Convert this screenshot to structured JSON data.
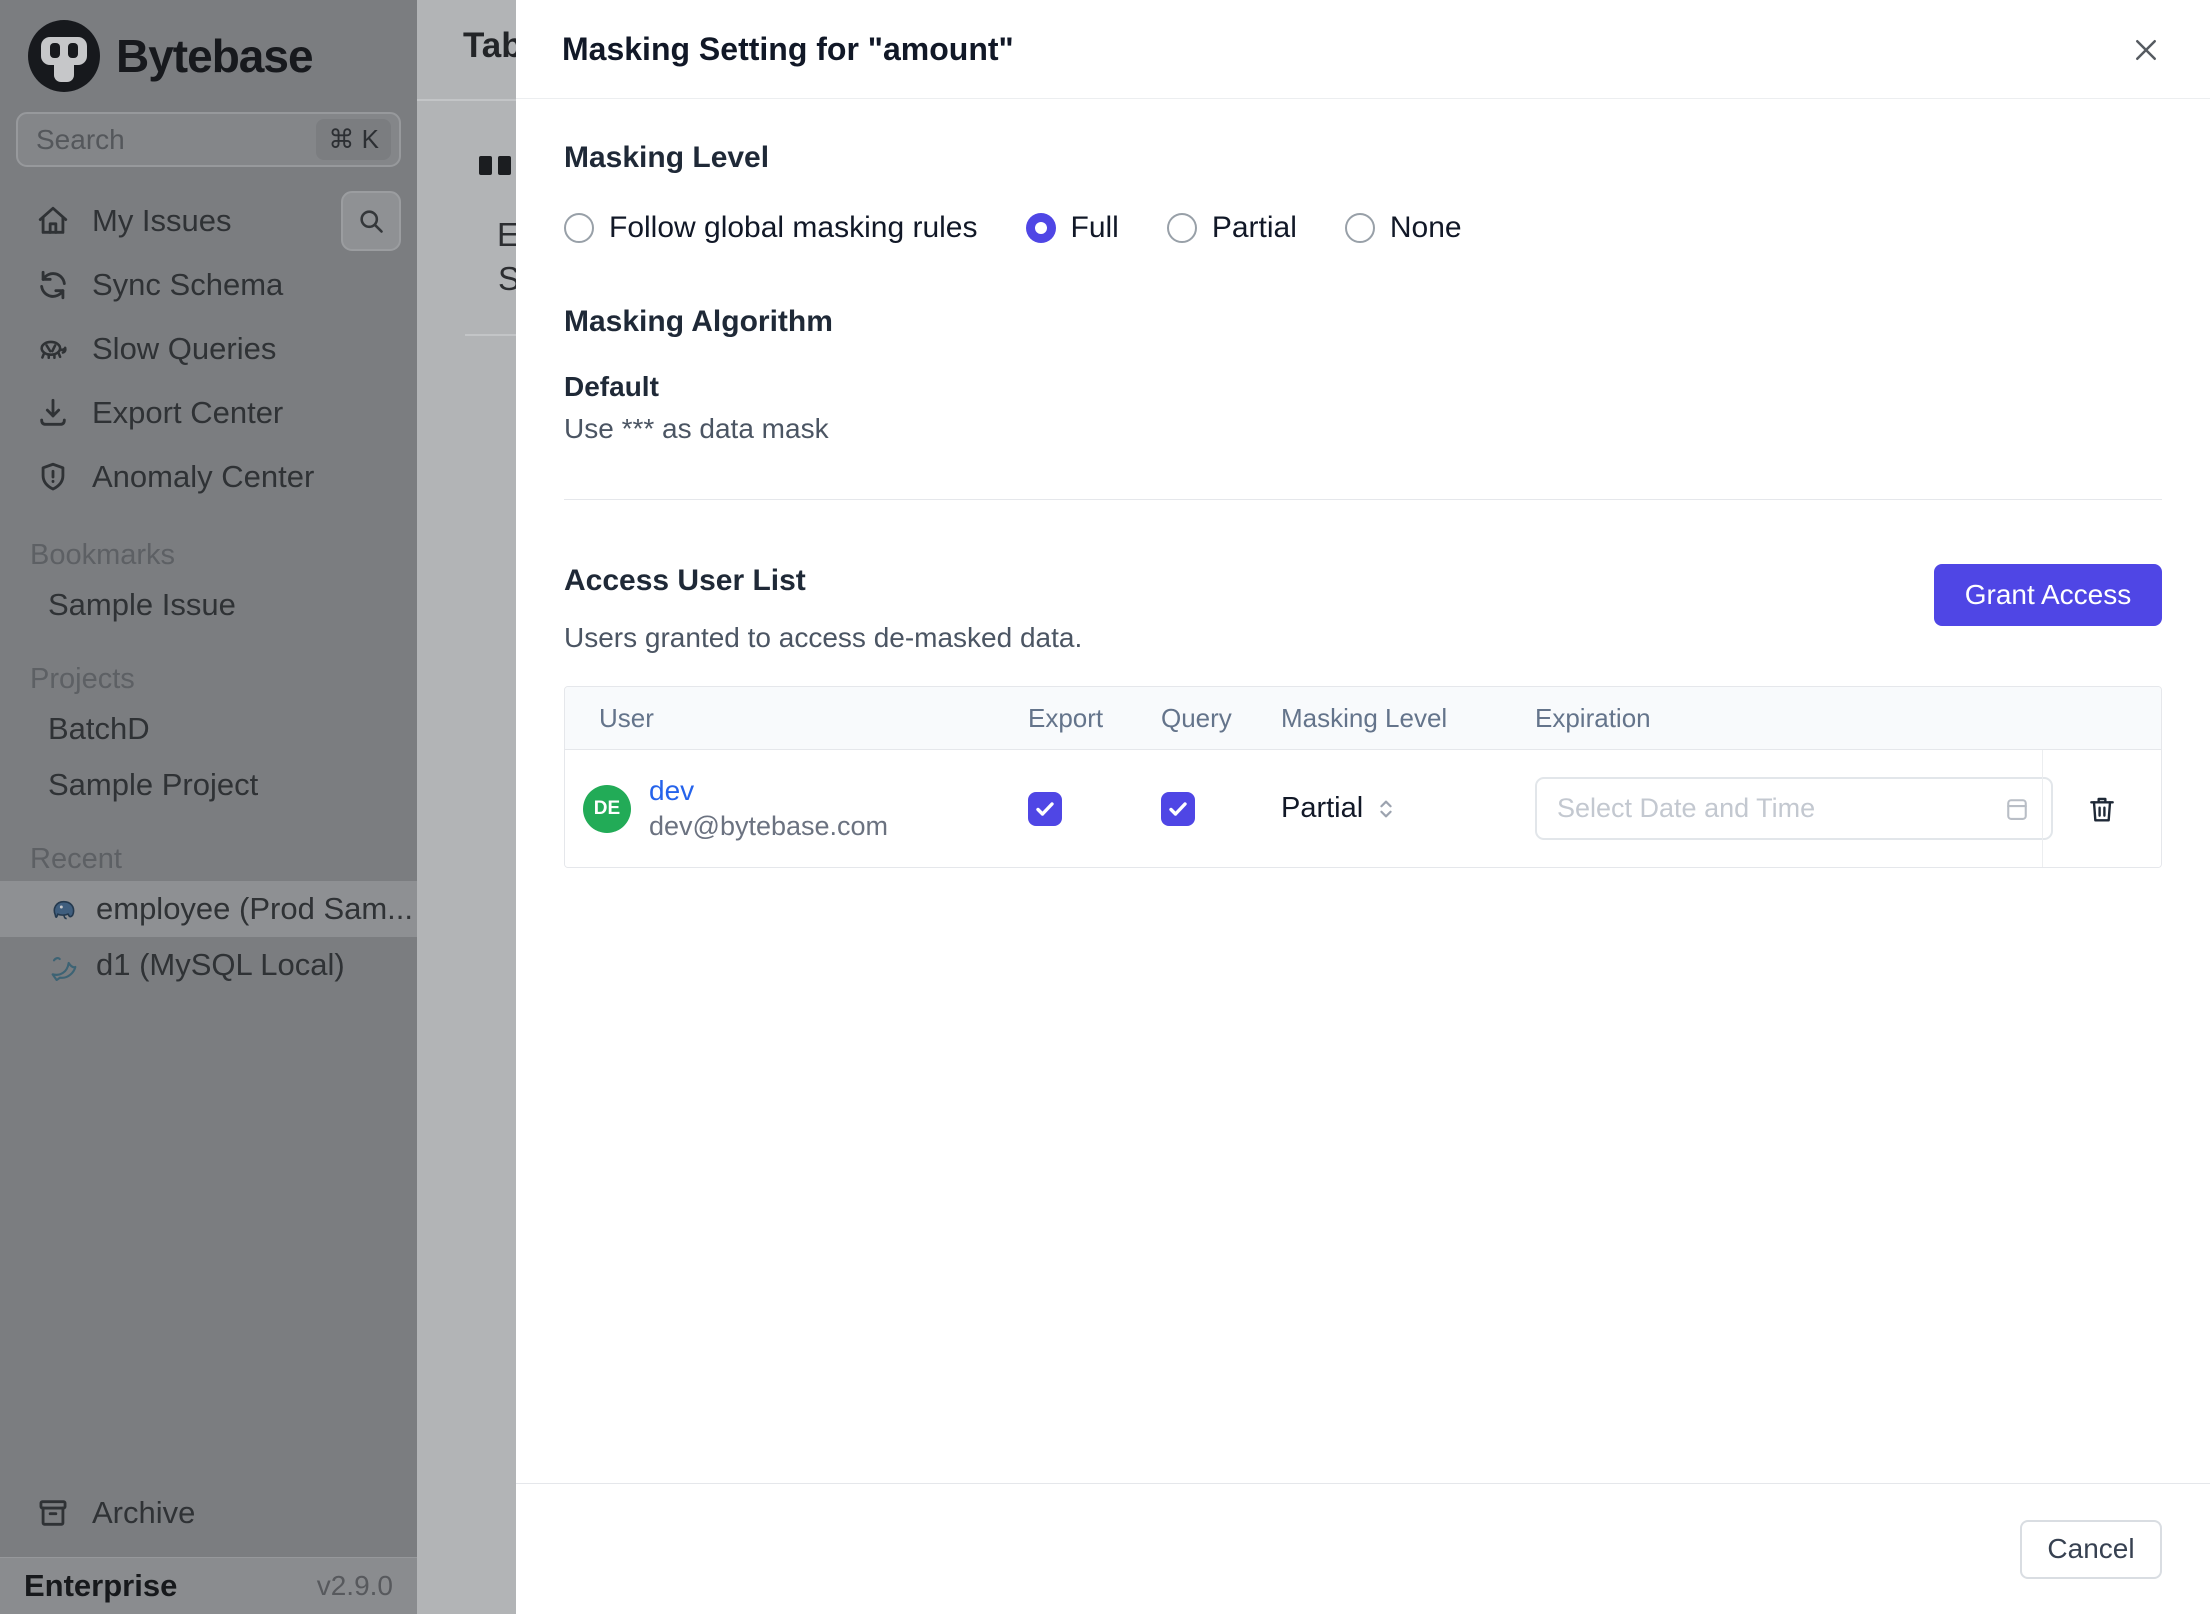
{
  "sidebar": {
    "brand": "Bytebase",
    "search": {
      "placeholder": "Search",
      "shortcut": "⌘ K"
    },
    "nav": [
      {
        "label": "My Issues",
        "icon": "home-icon"
      },
      {
        "label": "Sync Schema",
        "icon": "sync-icon"
      },
      {
        "label": "Slow Queries",
        "icon": "turtle-icon"
      },
      {
        "label": "Export Center",
        "icon": "download-icon"
      },
      {
        "label": "Anomaly Center",
        "icon": "shield-icon"
      }
    ],
    "sections": [
      {
        "label": "Bookmarks",
        "items": [
          {
            "label": "Sample Issue",
            "selected": false
          }
        ]
      },
      {
        "label": "Projects",
        "items": [
          {
            "label": "BatchD",
            "selected": false
          },
          {
            "label": "Sample Project",
            "selected": false
          }
        ]
      },
      {
        "label": "Recent",
        "items": [
          {
            "label": "employee (Prod Sam...",
            "icon": "postgres-icon",
            "selected": true
          },
          {
            "label": "d1 (MySQL Local)",
            "icon": "mysql-icon",
            "selected": false
          }
        ]
      }
    ],
    "archive": {
      "label": "Archive",
      "icon": "archive-icon"
    },
    "footer": {
      "plan": "Enterprise",
      "version": "v2.9.0"
    }
  },
  "backdrop": {
    "tab_text": "Tab",
    "fragment_1": "E",
    "fragment_2": "S"
  },
  "dialog": {
    "title": "Masking Setting for \"amount\"",
    "masking_level": {
      "heading": "Masking Level",
      "options": [
        {
          "label": "Follow global masking rules",
          "selected": false
        },
        {
          "label": "Full",
          "selected": true
        },
        {
          "label": "Partial",
          "selected": false
        },
        {
          "label": "None",
          "selected": false
        }
      ]
    },
    "masking_algorithm": {
      "heading": "Masking Algorithm",
      "name": "Default",
      "description": "Use *** as data mask"
    },
    "access_user_list": {
      "heading": "Access User List",
      "subtitle": "Users granted to access de-masked data.",
      "grant_button": "Grant Access",
      "table": {
        "columns": [
          "User",
          "Export",
          "Query",
          "Masking Level",
          "Expiration"
        ],
        "rows": [
          {
            "avatar_initials": "DE",
            "name": "dev",
            "email": "dev@bytebase.com",
            "export": true,
            "query": true,
            "masking_level": "Partial",
            "expiration_placeholder": "Select Date and Time"
          }
        ]
      }
    },
    "footer": {
      "cancel_label": "Cancel"
    }
  },
  "colors": {
    "accent": "#4f46e5",
    "link": "#2563eb",
    "avatar_green": "#22ab57"
  }
}
